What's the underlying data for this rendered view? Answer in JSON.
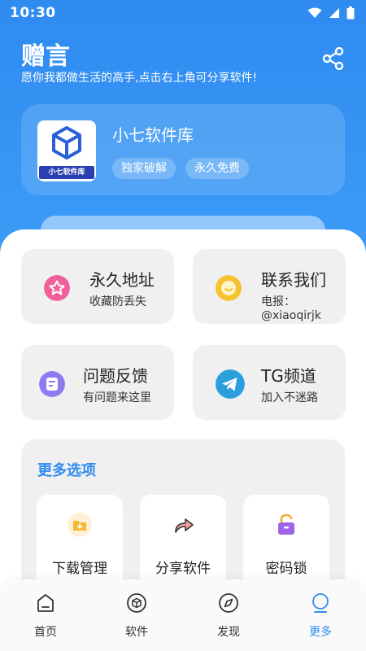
{
  "status_bar": {
    "time": "10:30"
  },
  "header": {
    "title": "赠言",
    "subtitle": "愿你我都做生活的高手,点击右上角可分享软件!"
  },
  "app_card": {
    "logo_text": "小七软件库",
    "name": "小七软件库",
    "tags": [
      "独家破解",
      "永久免费"
    ]
  },
  "tiles": [
    {
      "title": "永久地址",
      "subtitle": "收藏防丢失",
      "icon": "star-icon",
      "color": "#f0609a"
    },
    {
      "title": "联系我们",
      "subtitle": "电报：@xiaoqirjk",
      "icon": "chat-icon",
      "color": "#f5c230"
    },
    {
      "title": "问题反馈",
      "subtitle": "有问题来这里",
      "icon": "feedback-icon",
      "color": "#8c7cf0"
    },
    {
      "title": "TG频道",
      "subtitle": "加入不迷路",
      "icon": "telegram-icon",
      "color": "#2a9fdc"
    }
  ],
  "more_options": {
    "title": "更多选项",
    "items": [
      {
        "label": "下载管理",
        "icon": "download-folder-icon"
      },
      {
        "label": "分享软件",
        "icon": "share-arrow-icon"
      },
      {
        "label": "密码锁",
        "icon": "lock-icon"
      }
    ]
  },
  "tabbar": {
    "items": [
      {
        "label": "首页",
        "icon": "home-icon"
      },
      {
        "label": "软件",
        "icon": "cube-icon"
      },
      {
        "label": "发现",
        "icon": "compass-icon"
      },
      {
        "label": "更多",
        "icon": "more-icon",
        "active": true
      }
    ]
  },
  "colors": {
    "primary": "#2f8bf0",
    "tile_bg": "#f0f0f1"
  }
}
